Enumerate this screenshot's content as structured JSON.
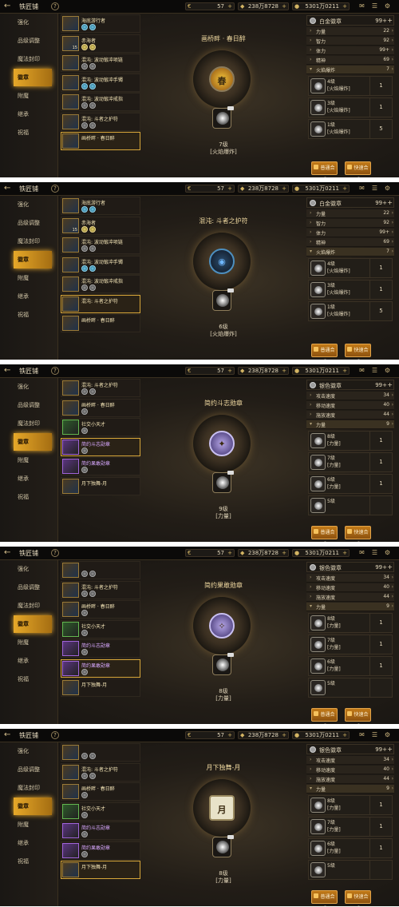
{
  "common": {
    "title": "铁匠铺",
    "help": "?",
    "back": "←",
    "cur1": {
      "icon": "€",
      "value": "57"
    },
    "cur2": {
      "icon": "◆",
      "value": "238万8728"
    },
    "cur3": {
      "icon": "●",
      "value": "5301万0211"
    },
    "plus": "+",
    "icons": [
      "✉",
      "☰",
      "⚙"
    ],
    "sidebar": [
      "强化",
      "品级调整",
      "魔法封印",
      "徽章",
      "附魔",
      "继承",
      "祝福"
    ],
    "buttons": {
      "normal": "普通合成",
      "fast": "快速合成"
    }
  },
  "panels": [
    {
      "items": [
        {
          "name": "海底游行者",
          "cls": "",
          "icon": "",
          "lv": "",
          "gems": [
            "b",
            "b"
          ],
          "sel": false
        },
        {
          "name": "赤海者",
          "cls": "",
          "icon": "",
          "lv": "15",
          "gems": [
            "y",
            "y"
          ],
          "sel": false
        },
        {
          "name": "混沌: 波动锻冲项链",
          "cls": "",
          "icon": "",
          "lv": "",
          "gems": [
            "g",
            "g"
          ],
          "sel": false
        },
        {
          "name": "混沌: 波动锻冲手镯",
          "cls": "",
          "icon": "",
          "lv": "",
          "gems": [
            "b",
            "b"
          ],
          "sel": false
        },
        {
          "name": "混沌: 波动锻冲戒指",
          "cls": "",
          "icon": "",
          "lv": "",
          "gems": [
            "g",
            "g"
          ],
          "sel": false
        },
        {
          "name": "混沌: 斗者之护符",
          "cls": "",
          "icon": "",
          "lv": "",
          "gems": [
            "g",
            "g"
          ],
          "sel": false
        },
        {
          "name": "画桥畔 · 春日醉",
          "cls": "",
          "icon": "",
          "lv": "",
          "gems": [],
          "sel": true
        }
      ],
      "emblem": {
        "name": "画桥畔 · 春日醉",
        "core": "gold",
        "glyph": "春",
        "level": "7级",
        "type": "[火焰爆炸]"
      },
      "right": {
        "head": {
          "title": "白金徽章",
          "count": "99+"
        },
        "stats": [
          {
            "label": "力量",
            "val": "22",
            "hl": false
          },
          {
            "label": "智力",
            "val": "92",
            "hl": false
          },
          {
            "label": "体力",
            "val": "99+",
            "hl": false
          },
          {
            "label": "精神",
            "val": "69",
            "hl": false
          },
          {
            "label": "火焰爆炸",
            "val": "7",
            "hl": true
          }
        ],
        "grades": [
          {
            "text1": "4级",
            "text2": "[火焰爆炸]",
            "count": "1"
          },
          {
            "text1": "3级",
            "text2": "[火焰爆炸]",
            "count": "1"
          },
          {
            "text1": "1级",
            "text2": "[火焰爆炸]",
            "count": "5"
          }
        ]
      }
    },
    {
      "items": [
        {
          "name": "海底游行者",
          "cls": "",
          "icon": "",
          "lv": "",
          "gems": [
            "b",
            "b"
          ],
          "sel": false
        },
        {
          "name": "赤海者",
          "cls": "",
          "icon": "",
          "lv": "15",
          "gems": [
            "y",
            "y"
          ],
          "sel": false
        },
        {
          "name": "混沌: 波动锻冲项链",
          "cls": "",
          "icon": "",
          "lv": "",
          "gems": [
            "g",
            "g"
          ],
          "sel": false
        },
        {
          "name": "混沌: 波动锻冲手镯",
          "cls": "",
          "icon": "",
          "lv": "",
          "gems": [
            "b",
            "b"
          ],
          "sel": false
        },
        {
          "name": "混沌: 波动锻冲戒指",
          "cls": "",
          "icon": "",
          "lv": "",
          "gems": [
            "g",
            "g"
          ],
          "sel": false
        },
        {
          "name": "混沌: 斗者之护符",
          "cls": "",
          "icon": "",
          "lv": "",
          "gems": [],
          "sel": true
        },
        {
          "name": "画桥畔 · 春日醉",
          "cls": "",
          "icon": "",
          "lv": "",
          "gems": [],
          "sel": false
        }
      ],
      "emblem": {
        "name": "混沌: 斗者之护符",
        "core": "blue",
        "glyph": "◉",
        "level": "6级",
        "type": "[火焰爆炸]"
      },
      "right": {
        "head": {
          "title": "白金徽章",
          "count": "99+"
        },
        "stats": [
          {
            "label": "力量",
            "val": "22",
            "hl": false
          },
          {
            "label": "智力",
            "val": "92",
            "hl": false
          },
          {
            "label": "体力",
            "val": "99+",
            "hl": false
          },
          {
            "label": "精神",
            "val": "69",
            "hl": false
          },
          {
            "label": "火焰爆炸",
            "val": "7",
            "hl": true
          }
        ],
        "grades": [
          {
            "text1": "4级",
            "text2": "[火焰爆炸]",
            "count": "1"
          },
          {
            "text1": "3级",
            "text2": "[火焰爆炸]",
            "count": "1"
          },
          {
            "text1": "1级",
            "text2": "[火焰爆炸]",
            "count": "5"
          }
        ]
      }
    },
    {
      "items": [
        {
          "name": "混沌: 斗者之护符",
          "cls": "",
          "icon": "",
          "lv": "",
          "gems": [
            "g",
            "g"
          ],
          "sel": false
        },
        {
          "name": "画桥畔 · 春日醉",
          "cls": "",
          "icon": "",
          "lv": "",
          "gems": [
            "g"
          ],
          "sel": false
        },
        {
          "name": "社交小天才",
          "cls": "green",
          "icon": "",
          "lv": "",
          "gems": [
            "g"
          ],
          "sel": false
        },
        {
          "name": "简约斗志勋章",
          "cls": "purple",
          "icon": "",
          "lv": "",
          "gems": [
            "g"
          ],
          "sel": true
        },
        {
          "name": "简约果敢勋章",
          "cls": "purple",
          "icon": "",
          "lv": "",
          "gems": [
            "g"
          ],
          "sel": false
        },
        {
          "name": "月下独舞-月",
          "cls": "",
          "icon": "",
          "lv": "",
          "gems": [],
          "sel": false
        }
      ],
      "emblem": {
        "name": "简约斗志勋章",
        "core": "purple",
        "glyph": "✦",
        "level": "9级",
        "type": "[力量]"
      },
      "right": {
        "head": {
          "title": "银色徽章",
          "count": "99+"
        },
        "stats": [
          {
            "label": "攻击速度",
            "val": "34",
            "hl": false
          },
          {
            "label": "移动速度",
            "val": "40",
            "hl": false
          },
          {
            "label": "施放速度",
            "val": "44",
            "hl": false
          },
          {
            "label": "力量",
            "val": "9",
            "hl": true
          }
        ],
        "grades": [
          {
            "text1": "8级",
            "text2": "[力量]",
            "count": "1"
          },
          {
            "text1": "7级",
            "text2": "[力量]",
            "count": "1"
          },
          {
            "text1": "6级",
            "text2": "[力量]",
            "count": "1"
          },
          {
            "text1": "5级",
            "text2": "",
            "count": ""
          }
        ]
      }
    },
    {
      "items": [
        {
          "name": "",
          "cls": "",
          "icon": "",
          "lv": "",
          "gems": [
            "g",
            "g"
          ],
          "sel": false
        },
        {
          "name": "混沌: 斗者之护符",
          "cls": "",
          "icon": "",
          "lv": "",
          "gems": [
            "g",
            "g"
          ],
          "sel": false
        },
        {
          "name": "画桥畔 · 春日醉",
          "cls": "",
          "icon": "",
          "lv": "",
          "gems": [
            "g"
          ],
          "sel": false
        },
        {
          "name": "社交小天才",
          "cls": "green",
          "icon": "",
          "lv": "",
          "gems": [
            "g"
          ],
          "sel": false
        },
        {
          "name": "简约斗志勋章",
          "cls": "purple",
          "icon": "",
          "lv": "",
          "gems": [
            "g"
          ],
          "sel": false
        },
        {
          "name": "简约果敢勋章",
          "cls": "purple",
          "icon": "",
          "lv": "",
          "gems": [
            "g"
          ],
          "sel": true
        },
        {
          "name": "月下独舞-月",
          "cls": "",
          "icon": "",
          "lv": "",
          "gems": [],
          "sel": false
        }
      ],
      "emblem": {
        "name": "简约果敢勋章",
        "core": "purple",
        "glyph": "✧",
        "level": "8级",
        "type": "[力量]"
      },
      "right": {
        "head": {
          "title": "银色徽章",
          "count": "99+"
        },
        "stats": [
          {
            "label": "攻击速度",
            "val": "34",
            "hl": false
          },
          {
            "label": "移动速度",
            "val": "40",
            "hl": false
          },
          {
            "label": "施放速度",
            "val": "44",
            "hl": false
          },
          {
            "label": "力量",
            "val": "9",
            "hl": true
          }
        ],
        "grades": [
          {
            "text1": "8级",
            "text2": "[力量]",
            "count": "1"
          },
          {
            "text1": "7级",
            "text2": "[力量]",
            "count": "1"
          },
          {
            "text1": "6级",
            "text2": "[力量]",
            "count": "1"
          },
          {
            "text1": "5级",
            "text2": "",
            "count": ""
          }
        ]
      }
    },
    {
      "items": [
        {
          "name": "",
          "cls": "",
          "icon": "",
          "lv": "",
          "gems": [
            "g",
            "g"
          ],
          "sel": false
        },
        {
          "name": "混沌: 斗者之护符",
          "cls": "",
          "icon": "",
          "lv": "",
          "gems": [
            "g",
            "g"
          ],
          "sel": false
        },
        {
          "name": "画桥畔 · 春日醉",
          "cls": "",
          "icon": "",
          "lv": "",
          "gems": [
            "g"
          ],
          "sel": false
        },
        {
          "name": "社交小天才",
          "cls": "green",
          "icon": "",
          "lv": "",
          "gems": [
            "g"
          ],
          "sel": false
        },
        {
          "name": "简约斗志勋章",
          "cls": "purple",
          "icon": "",
          "lv": "",
          "gems": [
            "g"
          ],
          "sel": false
        },
        {
          "name": "简约果敢勋章",
          "cls": "purple",
          "icon": "",
          "lv": "",
          "gems": [
            "g"
          ],
          "sel": false
        },
        {
          "name": "月下独舞-月",
          "cls": "",
          "icon": "",
          "lv": "",
          "gems": [],
          "sel": true
        }
      ],
      "emblem": {
        "name": "月下独舞-月",
        "core": "paper",
        "glyph": "月",
        "level": "8级",
        "type": "[力量]"
      },
      "right": {
        "head": {
          "title": "银色徽章",
          "count": "99+"
        },
        "stats": [
          {
            "label": "攻击速度",
            "val": "34",
            "hl": false
          },
          {
            "label": "移动速度",
            "val": "40",
            "hl": false
          },
          {
            "label": "施放速度",
            "val": "44",
            "hl": false
          },
          {
            "label": "力量",
            "val": "9",
            "hl": true
          }
        ],
        "grades": [
          {
            "text1": "8级",
            "text2": "[力量]",
            "count": "1"
          },
          {
            "text1": "7级",
            "text2": "[力量]",
            "count": "1"
          },
          {
            "text1": "6级",
            "text2": "[力量]",
            "count": "1"
          },
          {
            "text1": "5级",
            "text2": "",
            "count": ""
          }
        ]
      }
    }
  ]
}
